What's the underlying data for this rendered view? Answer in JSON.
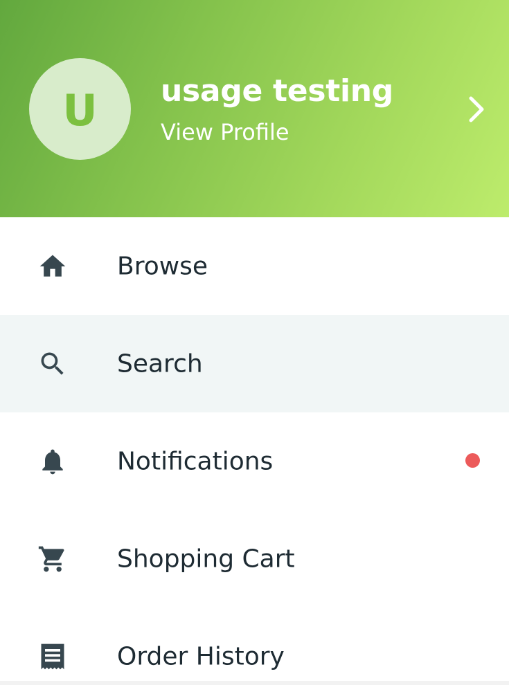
{
  "profile": {
    "avatar_initial": "U",
    "name": "usage testing",
    "link_label": "View Profile"
  },
  "menu": {
    "items": [
      {
        "label": "Browse",
        "icon": "home-icon"
      },
      {
        "label": "Search",
        "icon": "search-icon",
        "active": true
      },
      {
        "label": "Notifications",
        "icon": "bell-icon",
        "badge": "unread-dot"
      },
      {
        "label": "Shopping Cart",
        "icon": "cart-icon"
      },
      {
        "label": "Order History",
        "icon": "receipt-icon"
      }
    ]
  },
  "colors": {
    "header_gradient_start": "#62a83e",
    "header_gradient_end": "#bdec6c",
    "avatar_bg": "#d8eccb",
    "avatar_letter": "#7cc03f",
    "active_row_bg": "#f1f6f6",
    "text": "#1e2b33",
    "icon": "#37474f",
    "badge": "#ec5a5a"
  }
}
